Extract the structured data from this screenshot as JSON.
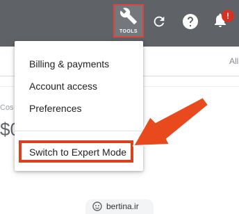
{
  "topbar": {
    "tools_label": "TOOLS",
    "notification_count": "!",
    "icons": [
      "wrench-icon",
      "refresh-icon",
      "help-icon",
      "bell-icon"
    ],
    "colors": {
      "bar": "#5f6368",
      "highlight": "#e0433a",
      "badge": "#d93025"
    }
  },
  "background": {
    "tab_partial": "All",
    "card_label_partial": "Cos",
    "card_value_partial": "$0"
  },
  "menu": {
    "items": [
      {
        "label": "Billing & payments"
      },
      {
        "label": "Account access"
      },
      {
        "label": "Preferences"
      }
    ],
    "expert_mode": "Switch to Expert Mode"
  },
  "annotation": {
    "arrow_color": "#e8491d",
    "box_color": "#d9421c"
  },
  "watermark": {
    "text": "bertina.ir",
    "icon": "bertina-logo-icon"
  }
}
